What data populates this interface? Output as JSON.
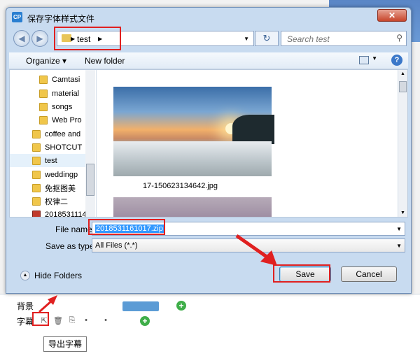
{
  "dialog": {
    "title": "保存字体样式文件",
    "app_icon_text": "CP",
    "close_glyph": "✕"
  },
  "nav": {
    "back_glyph": "◀",
    "forward_glyph": "▶",
    "address_path": "test",
    "refresh_glyph": "↻",
    "search_placeholder": "Search test"
  },
  "toolbar": {
    "organize_label": "Organize ▾",
    "new_folder_label": "New folder",
    "help_glyph": "?"
  },
  "tree": {
    "items": [
      {
        "label": "Camtasi"
      },
      {
        "label": "material"
      },
      {
        "label": "songs"
      },
      {
        "label": "Web Pro"
      },
      {
        "label": "coffee and"
      },
      {
        "label": "SHOTCUT"
      },
      {
        "label": "test"
      },
      {
        "label": "weddingp"
      },
      {
        "label": "免抠图美"
      },
      {
        "label": "权律二"
      },
      {
        "label": "2018531114"
      }
    ]
  },
  "files": {
    "items": [
      {
        "name": "17-150623134642.jpg"
      }
    ]
  },
  "form": {
    "file_name_label": "File name:",
    "file_name_value": "2018531161017.zip",
    "save_type_label": "Save as type:",
    "save_type_value": "All Files (*.*)"
  },
  "footer": {
    "hide_folders_label": "Hide Folders",
    "save_label": "Save",
    "cancel_label": "Cancel"
  },
  "background": {
    "row1_label": "背景",
    "row2_label": "字幕",
    "tooltip": "导出字幕",
    "plus_glyph": "+"
  },
  "colors": {
    "annotation_red": "#e02020",
    "selection_blue": "#3399ff"
  }
}
